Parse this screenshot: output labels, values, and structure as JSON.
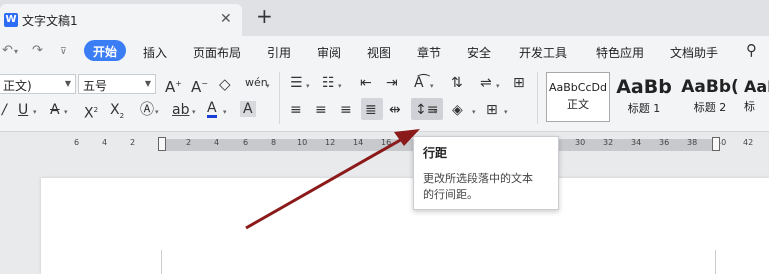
{
  "titlebar": {
    "logo": "W",
    "doc_title": "文字文稿1",
    "close_glyph": "✕",
    "new_tab_glyph": "+"
  },
  "menubar": {
    "items": [
      "开始",
      "插入",
      "页面布局",
      "引用",
      "审阅",
      "视图",
      "章节",
      "安全",
      "开发工具",
      "特色应用",
      "文档助手"
    ],
    "active_index": 0,
    "accent_color": "#3b7df5"
  },
  "ribbon": {
    "style_combo_value": "正文)",
    "size_combo_value": "五号",
    "styles": [
      {
        "preview": "AaBbCcDd",
        "name": "正文"
      },
      {
        "preview": "AaBb",
        "name": "标题 1"
      },
      {
        "preview": "AaBb(",
        "name": "标题 2"
      },
      {
        "preview": "AaB",
        "name": "标"
      }
    ]
  },
  "ruler": {
    "labels": [
      "6",
      "4",
      "2",
      "2",
      "4",
      "6",
      "8",
      "10",
      "12",
      "14",
      "16",
      "30",
      "32",
      "34",
      "36",
      "38",
      "40",
      "42"
    ]
  },
  "tooltip": {
    "title": "行距",
    "description_line1": "更改所选段落中的文本",
    "description_line2": "的行间距。"
  },
  "colors": {
    "arrow": "#8b1a1a",
    "font_color_underline": "#1a3fd6",
    "page": "#ffffff"
  }
}
